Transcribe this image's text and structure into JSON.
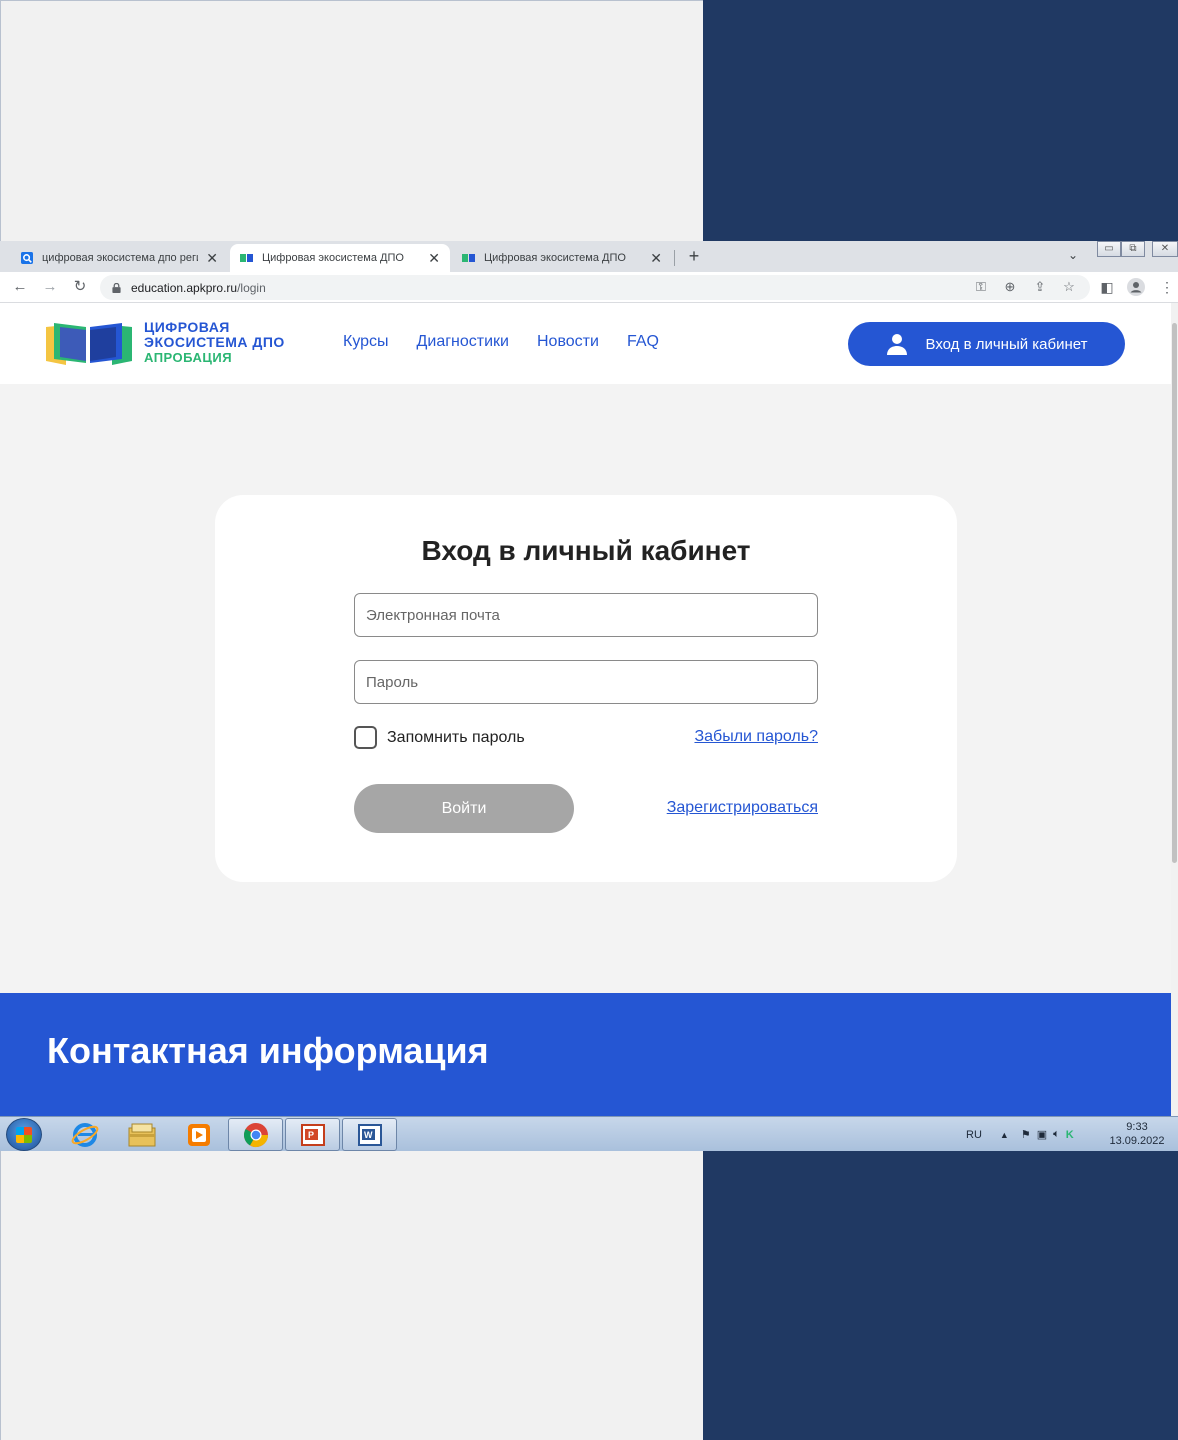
{
  "tabs": [
    {
      "title": "цифровая экосистема дпо реги",
      "close": "✕"
    },
    {
      "title": "Цифровая экосистема ДПО",
      "close": "✕"
    },
    {
      "title": "Цифровая экосистема ДПО",
      "close": "✕"
    }
  ],
  "new_tab": "+",
  "address": {
    "host": "education.apkpro.ru",
    "path": "/login"
  },
  "site": {
    "logo_line1": "ЦИФРОВАЯ",
    "logo_line2": "ЭКОСИСТЕМА ДПО",
    "logo_line3": "АПРОБАЦИЯ",
    "nav": [
      "Курсы",
      "Диагностики",
      "Новости",
      "FAQ"
    ],
    "login_button": "Вход в личный кабинет"
  },
  "login_card": {
    "title": "Вход в личный кабинет",
    "email_placeholder": "Электронная почта",
    "password_placeholder": "Пароль",
    "remember_label": "Запомнить пароль",
    "remember_checked": false,
    "forgot_link": "Забыли пароль?",
    "submit_label": "Войти",
    "register_link": "Зарегистрироваться"
  },
  "footer": {
    "title": "Контактная информация"
  },
  "taskbar": {
    "language": "RU",
    "time": "9:33",
    "date": "13.09.2022"
  },
  "colors": {
    "brand_blue": "#2556d3",
    "brand_green": "#2bb673",
    "disabled_button": "#a6a6a6",
    "backdrop_navy": "#203963"
  }
}
